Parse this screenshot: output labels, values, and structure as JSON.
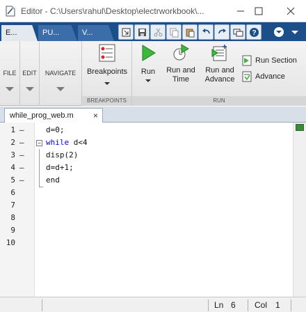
{
  "window": {
    "title": "Editor - C:\\Users\\rahul\\Desktop\\electrworkbook\\..."
  },
  "ribbon_tabs": [
    {
      "label": "E..."
    },
    {
      "label": "PU..."
    },
    {
      "label": "V..."
    }
  ],
  "quick_access": [
    {
      "icon": "dock-icon"
    },
    {
      "icon": "save-icon"
    },
    {
      "icon": "cut-icon"
    },
    {
      "icon": "copy-icon"
    },
    {
      "icon": "paste-icon"
    },
    {
      "icon": "undo-icon"
    },
    {
      "icon": "redo-icon"
    },
    {
      "icon": "switch-windows-icon"
    },
    {
      "icon": "help-icon"
    },
    {
      "icon": "expand-icon"
    }
  ],
  "ribbon": {
    "file_label": "FILE",
    "edit_label": "EDIT",
    "navigate_label": "NAVIGATE",
    "breakpoints": {
      "button_label": "Breakpoints",
      "group_title": "BREAKPOINTS"
    },
    "run_group": {
      "group_title": "RUN",
      "run_label": "Run",
      "run_and_time_label": "Run and\nTime",
      "run_and_advance_label": "Run and\nAdvance",
      "run_section_label": "Run Section",
      "advance_label": "Advance"
    }
  },
  "document": {
    "tab_label": "while_prog_web.m",
    "close_glyph": "×"
  },
  "code_lines": [
    {
      "num": "1",
      "marker": "–",
      "text": "d=0;"
    },
    {
      "num": "2",
      "marker": "–",
      "keyword": "while",
      "text": " d<4"
    },
    {
      "num": "3",
      "marker": "–",
      "text": "disp(2)"
    },
    {
      "num": "4",
      "marker": "–",
      "text": "d=d+1;"
    },
    {
      "num": "5",
      "marker": "–",
      "keyword": "end",
      "text": ""
    },
    {
      "num": "6",
      "marker": "",
      "text": ""
    },
    {
      "num": "7",
      "marker": "",
      "text": ""
    },
    {
      "num": "8",
      "marker": "",
      "text": ""
    },
    {
      "num": "9",
      "marker": "",
      "text": ""
    },
    {
      "num": "10",
      "marker": "",
      "text": ""
    }
  ],
  "status": {
    "ln_label": "Ln",
    "ln_value": "6",
    "col_label": "Col",
    "col_value": "1"
  },
  "colors": {
    "keyword": "#0000ff",
    "ribbon_tab_strip": "#1b4f8a"
  }
}
